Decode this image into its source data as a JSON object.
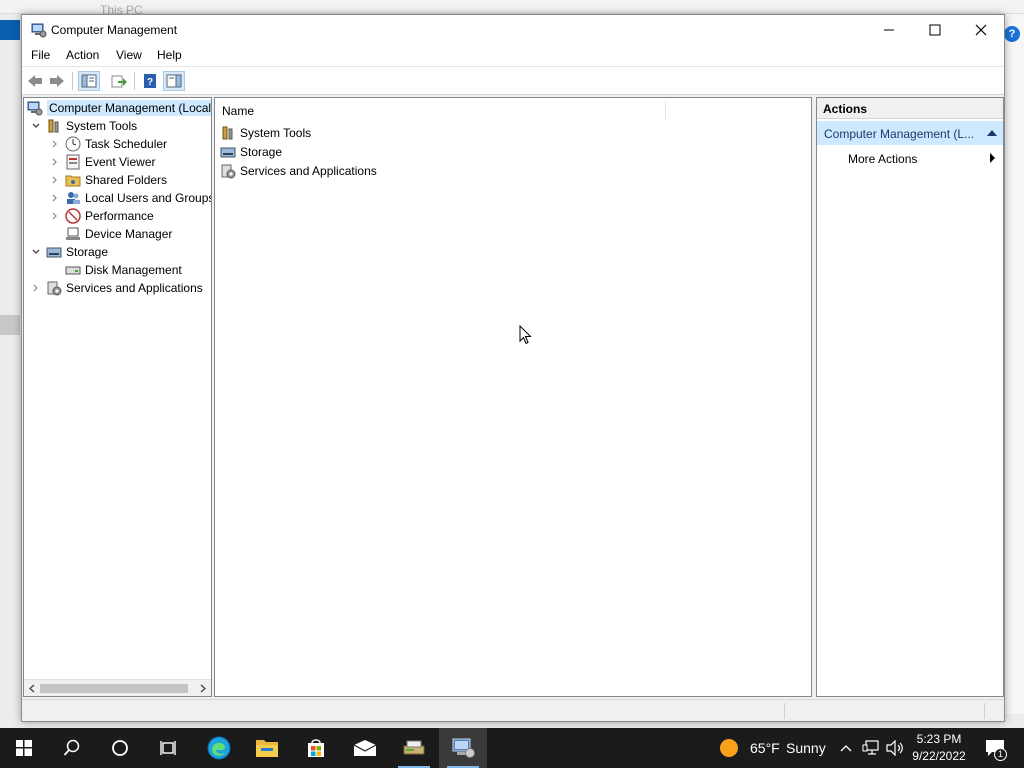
{
  "background_window": {
    "title": "This PC"
  },
  "window": {
    "title": "Computer Management",
    "menu": [
      "File",
      "Action",
      "View",
      "Help"
    ]
  },
  "tree": {
    "root": "Computer Management (Local",
    "system_tools": "System Tools",
    "task_scheduler": "Task Scheduler",
    "event_viewer": "Event Viewer",
    "shared_folders": "Shared Folders",
    "local_users": "Local Users and Groups",
    "performance": "Performance",
    "device_manager": "Device Manager",
    "storage": "Storage",
    "disk_management": "Disk Management",
    "services_apps": "Services and Applications"
  },
  "list": {
    "column_name": "Name",
    "items": [
      "System Tools",
      "Storage",
      "Services and Applications"
    ]
  },
  "actions": {
    "header": "Actions",
    "section": "Computer Management (L...",
    "more_actions": "More Actions"
  },
  "taskbar": {
    "weather_temp": "65°F",
    "weather_desc": "Sunny",
    "time": "5:23 PM",
    "date": "9/22/2022",
    "notification_count": "1"
  },
  "colors": {
    "selection": "#cde8ff",
    "taskbar": "#1b1b1b",
    "accent": "#0078d7"
  }
}
